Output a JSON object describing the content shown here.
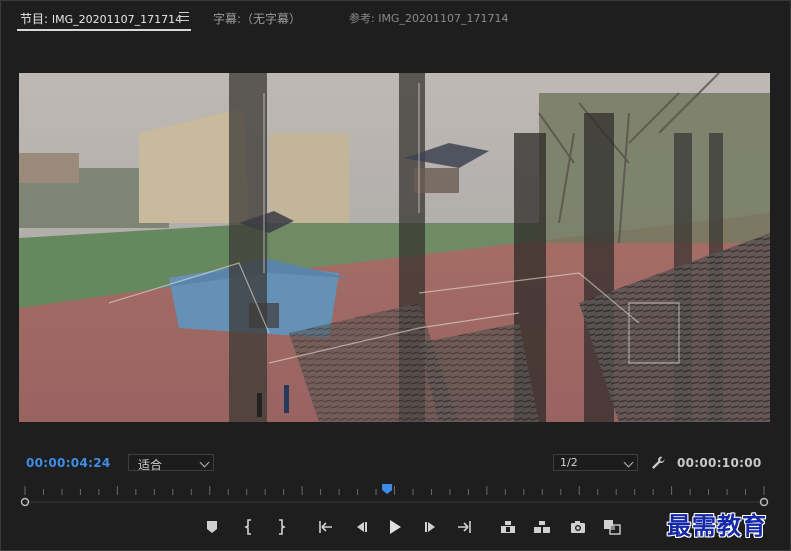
{
  "tabs": {
    "program": {
      "label": "节目:",
      "title": "IMG_20201107_171714"
    },
    "captions": {
      "label": "字幕:（无字幕）"
    },
    "reference": {
      "label": "参考: IMG_20201107_171714"
    }
  },
  "playback": {
    "current_timecode": "00:00:04:24",
    "duration_timecode": "00:00:10:00",
    "zoom_select": "适合",
    "resolution_select": "1/2",
    "playhead_fraction": 0.49
  },
  "colors": {
    "accent_blue": "#3d8ee8",
    "panel_bg": "#1e1e1e",
    "watermark": "#1428a8"
  },
  "transport_icons": [
    "add-marker-icon",
    "mark-in-icon",
    "mark-out-icon",
    "go-to-in-icon",
    "step-back-icon",
    "play-icon",
    "step-forward-icon",
    "go-to-out-icon",
    "lift-icon",
    "extract-icon",
    "export-frame-icon",
    "compare-view-icon"
  ],
  "watermark": {
    "text": "最需教育"
  }
}
